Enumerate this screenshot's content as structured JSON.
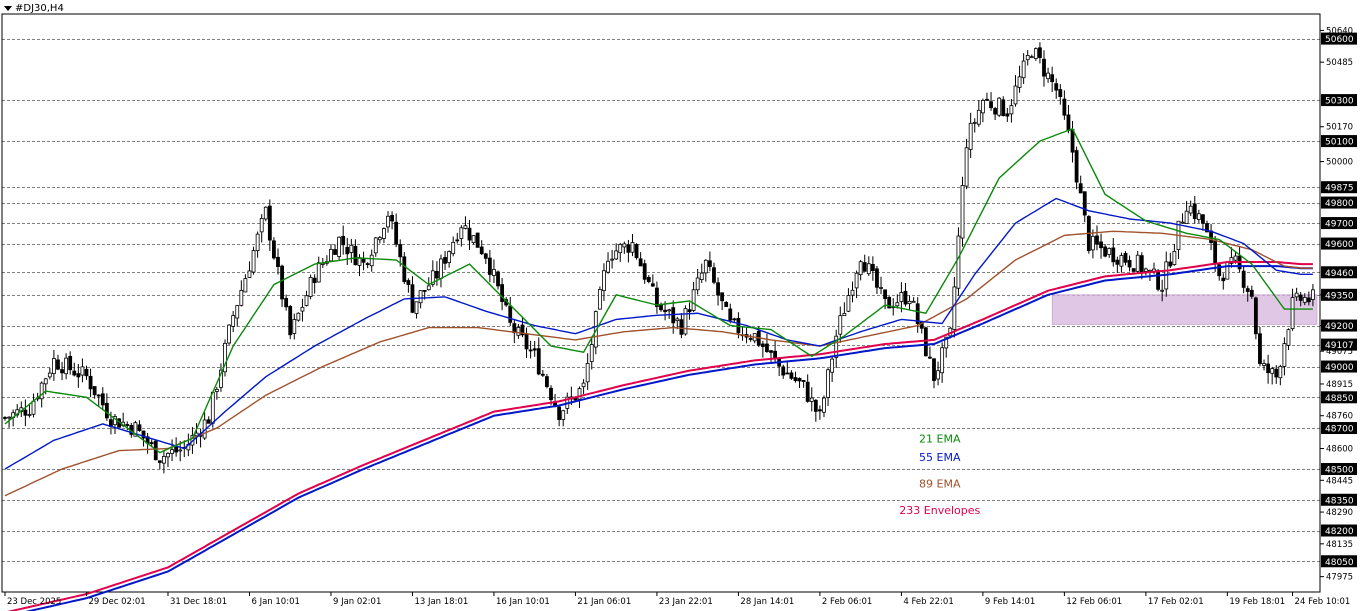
{
  "title": "#DJ30,H4",
  "colors": {
    "bull": "#000000",
    "bear": "#000000",
    "ema21": "#0a8a0a",
    "ema55": "#0018c8",
    "ema89": "#a0522d",
    "env_upper": "#e0004c",
    "env_lower": "#0018c8",
    "zone": "#d6b4dc",
    "grid": "#000000",
    "label_bg": "#000000",
    "label_text": "#ffffff"
  },
  "chart_data": {
    "type": "candlestick",
    "symbol": "#DJ30",
    "timeframe": "H4",
    "ylim": [
      47900,
      50720
    ],
    "y_ticks": [
      "50640",
      "50485",
      "50170",
      "50000",
      "49350",
      "49200",
      "49075",
      "48915",
      "48760",
      "48600",
      "48445",
      "48290",
      "48135",
      "47975"
    ],
    "price_labels": [
      {
        "text": "50600",
        "value": 50600,
        "style": "dark"
      },
      {
        "text": "50300",
        "value": 50300,
        "style": "dark"
      },
      {
        "text": "50100",
        "value": 50100,
        "style": "dark"
      },
      {
        "text": "49875",
        "value": 49875,
        "style": "dark"
      },
      {
        "text": "49800",
        "value": 49800,
        "style": "dark"
      },
      {
        "text": "49700",
        "value": 49700,
        "style": "dark"
      },
      {
        "text": "49600",
        "value": 49600,
        "style": "dark"
      },
      {
        "text": "49460",
        "value": 49460,
        "style": "dark"
      },
      {
        "text": "49350",
        "value": 49350,
        "style": "dark"
      },
      {
        "text": "49200",
        "value": 49200,
        "style": "dark"
      },
      {
        "text": "49107",
        "value": 49107,
        "style": "dark"
      },
      {
        "text": "49000",
        "value": 49000,
        "style": "dark"
      },
      {
        "text": "48850",
        "value": 48850,
        "style": "dark"
      },
      {
        "text": "48700",
        "value": 48700,
        "style": "dark"
      },
      {
        "text": "48500",
        "value": 48500,
        "style": "dark"
      },
      {
        "text": "48350",
        "value": 48350,
        "style": "dark"
      },
      {
        "text": "48200",
        "value": 48200,
        "style": "dark"
      },
      {
        "text": "48050",
        "value": 48050,
        "style": "dark"
      }
    ],
    "x_labels": [
      {
        "text": "23 Dec 2025",
        "bar": 0
      },
      {
        "text": "29 Dec 02:01",
        "bar": 20
      },
      {
        "text": "31 Dec 18:01",
        "bar": 40
      },
      {
        "text": "6 Jan 10:01",
        "bar": 60
      },
      {
        "text": "9 Jan 02:01",
        "bar": 80
      },
      {
        "text": "13 Jan 18:01",
        "bar": 100
      },
      {
        "text": "16 Jan 10:01",
        "bar": 120
      },
      {
        "text": "21 Jan 06:01",
        "bar": 140
      },
      {
        "text": "23 Jan 22:01",
        "bar": 160
      },
      {
        "text": "28 Jan 14:01",
        "bar": 180
      },
      {
        "text": "2 Feb 06:01",
        "bar": 200
      },
      {
        "text": "4 Feb 22:01",
        "bar": 220
      },
      {
        "text": "9 Feb 14:01",
        "bar": 240
      },
      {
        "text": "12 Feb 06:01",
        "bar": 260
      },
      {
        "text": "17 Feb 02:01",
        "bar": 280
      },
      {
        "text": "19 Feb 18:01",
        "bar": 300
      },
      {
        "text": "24 Feb 10:01",
        "bar": 316
      }
    ],
    "close_keypoints": [
      [
        0,
        48750
      ],
      [
        6,
        48800
      ],
      [
        12,
        49030
      ],
      [
        20,
        48950
      ],
      [
        26,
        48750
      ],
      [
        32,
        48700
      ],
      [
        38,
        48560
      ],
      [
        44,
        48600
      ],
      [
        50,
        48750
      ],
      [
        56,
        49250
      ],
      [
        64,
        49750
      ],
      [
        70,
        49150
      ],
      [
        76,
        49450
      ],
      [
        82,
        49620
      ],
      [
        88,
        49500
      ],
      [
        94,
        49750
      ],
      [
        100,
        49300
      ],
      [
        106,
        49450
      ],
      [
        112,
        49700
      ],
      [
        118,
        49550
      ],
      [
        124,
        49200
      ],
      [
        130,
        49050
      ],
      [
        136,
        48780
      ],
      [
        142,
        48900
      ],
      [
        148,
        49550
      ],
      [
        154,
        49600
      ],
      [
        160,
        49300
      ],
      [
        166,
        49200
      ],
      [
        172,
        49500
      ],
      [
        178,
        49200
      ],
      [
        184,
        49150
      ],
      [
        190,
        49000
      ],
      [
        196,
        48900
      ],
      [
        200,
        48750
      ],
      [
        204,
        49150
      ],
      [
        210,
        49550
      ],
      [
        216,
        49300
      ],
      [
        222,
        49350
      ],
      [
        228,
        48950
      ],
      [
        232,
        49150
      ],
      [
        236,
        50100
      ],
      [
        240,
        50300
      ],
      [
        246,
        50250
      ],
      [
        252,
        50550
      ],
      [
        258,
        50350
      ],
      [
        262,
        50050
      ],
      [
        266,
        49600
      ],
      [
        272,
        49550
      ],
      [
        278,
        49500
      ],
      [
        284,
        49400
      ],
      [
        290,
        49800
      ],
      [
        294,
        49700
      ],
      [
        298,
        49450
      ],
      [
        302,
        49500
      ],
      [
        306,
        49350
      ],
      [
        308,
        49000
      ],
      [
        312,
        48950
      ],
      [
        316,
        49300
      ],
      [
        318,
        49330
      ]
    ],
    "ema_keypoints": {
      "ema21": [
        [
          0,
          48720
        ],
        [
          10,
          48880
        ],
        [
          20,
          48850
        ],
        [
          30,
          48700
        ],
        [
          38,
          48580
        ],
        [
          46,
          48650
        ],
        [
          56,
          49100
        ],
        [
          66,
          49400
        ],
        [
          76,
          49500
        ],
        [
          86,
          49530
        ],
        [
          96,
          49520
        ],
        [
          104,
          49400
        ],
        [
          114,
          49500
        ],
        [
          124,
          49300
        ],
        [
          134,
          49100
        ],
        [
          142,
          49070
        ],
        [
          150,
          49350
        ],
        [
          160,
          49300
        ],
        [
          168,
          49320
        ],
        [
          178,
          49200
        ],
        [
          188,
          49180
        ],
        [
          198,
          49050
        ],
        [
          206,
          49150
        ],
        [
          216,
          49300
        ],
        [
          226,
          49260
        ],
        [
          234,
          49530
        ],
        [
          244,
          49920
        ],
        [
          254,
          50100
        ],
        [
          262,
          50160
        ],
        [
          270,
          49840
        ],
        [
          280,
          49710
        ],
        [
          290,
          49650
        ],
        [
          298,
          49620
        ],
        [
          306,
          49500
        ],
        [
          314,
          49280
        ],
        [
          318,
          49280
        ]
      ],
      "ema55": [
        [
          0,
          48500
        ],
        [
          12,
          48640
        ],
        [
          24,
          48720
        ],
        [
          34,
          48660
        ],
        [
          44,
          48600
        ],
        [
          54,
          48780
        ],
        [
          64,
          48950
        ],
        [
          76,
          49100
        ],
        [
          88,
          49230
        ],
        [
          98,
          49330
        ],
        [
          108,
          49340
        ],
        [
          118,
          49270
        ],
        [
          130,
          49200
        ],
        [
          140,
          49160
        ],
        [
          150,
          49230
        ],
        [
          160,
          49250
        ],
        [
          170,
          49260
        ],
        [
          182,
          49200
        ],
        [
          192,
          49130
        ],
        [
          200,
          49100
        ],
        [
          210,
          49170
        ],
        [
          220,
          49230
        ],
        [
          230,
          49210
        ],
        [
          238,
          49450
        ],
        [
          248,
          49700
        ],
        [
          258,
          49820
        ],
        [
          266,
          49760
        ],
        [
          276,
          49720
        ],
        [
          286,
          49700
        ],
        [
          296,
          49660
        ],
        [
          304,
          49600
        ],
        [
          312,
          49470
        ],
        [
          318,
          49450
        ]
      ],
      "ema89": [
        [
          0,
          48370
        ],
        [
          14,
          48500
        ],
        [
          28,
          48590
        ],
        [
          40,
          48600
        ],
        [
          52,
          48700
        ],
        [
          64,
          48860
        ],
        [
          78,
          49000
        ],
        [
          92,
          49120
        ],
        [
          104,
          49190
        ],
        [
          116,
          49190
        ],
        [
          128,
          49160
        ],
        [
          140,
          49130
        ],
        [
          152,
          49170
        ],
        [
          164,
          49190
        ],
        [
          176,
          49170
        ],
        [
          188,
          49130
        ],
        [
          200,
          49100
        ],
        [
          212,
          49150
        ],
        [
          224,
          49200
        ],
        [
          236,
          49330
        ],
        [
          248,
          49520
        ],
        [
          260,
          49640
        ],
        [
          272,
          49660
        ],
        [
          284,
          49650
        ],
        [
          296,
          49620
        ],
        [
          306,
          49570
        ],
        [
          314,
          49490
        ],
        [
          318,
          49480
        ]
      ],
      "env_upper": [
        [
          0,
          47800
        ],
        [
          20,
          47890
        ],
        [
          40,
          48020
        ],
        [
          56,
          48200
        ],
        [
          72,
          48380
        ],
        [
          88,
          48520
        ],
        [
          104,
          48650
        ],
        [
          120,
          48780
        ],
        [
          136,
          48830
        ],
        [
          152,
          48910
        ],
        [
          168,
          48980
        ],
        [
          184,
          49030
        ],
        [
          200,
          49060
        ],
        [
          216,
          49110
        ],
        [
          228,
          49130
        ],
        [
          240,
          49230
        ],
        [
          256,
          49370
        ],
        [
          270,
          49440
        ],
        [
          286,
          49470
        ],
        [
          300,
          49510
        ],
        [
          312,
          49510
        ],
        [
          318,
          49500
        ]
      ],
      "env_lower": [
        [
          0,
          47780
        ],
        [
          20,
          47870
        ],
        [
          40,
          48000
        ],
        [
          56,
          48180
        ],
        [
          72,
          48360
        ],
        [
          88,
          48500
        ],
        [
          104,
          48630
        ],
        [
          120,
          48760
        ],
        [
          136,
          48810
        ],
        [
          152,
          48890
        ],
        [
          168,
          48960
        ],
        [
          184,
          49010
        ],
        [
          200,
          49040
        ],
        [
          216,
          49090
        ],
        [
          228,
          49110
        ],
        [
          240,
          49210
        ],
        [
          256,
          49350
        ],
        [
          270,
          49420
        ],
        [
          286,
          49450
        ],
        [
          300,
          49490
        ],
        [
          312,
          49490
        ],
        [
          318,
          49480
        ]
      ]
    },
    "zone": {
      "x_start_bar": 257,
      "x_end_bar": 322,
      "y_top": 49350,
      "y_bottom": 49205
    },
    "annotations": [
      {
        "text": "21 EMA",
        "color_key": "ema21",
        "value": 48630,
        "bar": 225
      },
      {
        "text": "55 EMA",
        "color_key": "ema55",
        "value": 48540,
        "bar": 225
      },
      {
        "text": "89 EMA",
        "color_key": "ema89",
        "value": 48410,
        "bar": 225
      },
      {
        "text": "233 Envelopes",
        "color_key": "env_upper",
        "value": 48280,
        "bar": 225
      }
    ],
    "n_bars": 322,
    "grid": "dashed-horizontal",
    "legend": "none"
  }
}
